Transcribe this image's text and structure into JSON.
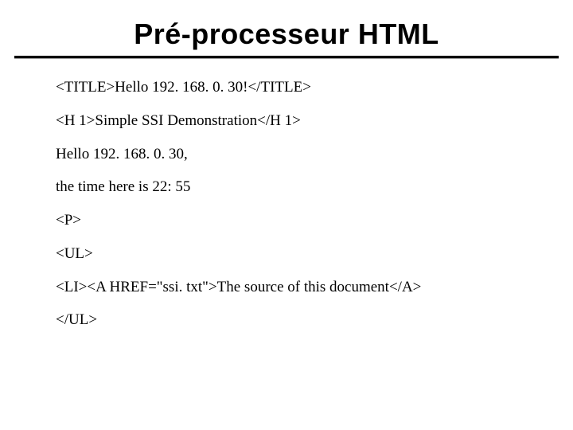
{
  "title": "Pré-processeur HTML",
  "lines": [
    "<TITLE>Hello 192. 168. 0. 30!</TITLE>",
    "<H 1>Simple SSI Demonstration</H 1>",
    "Hello 192. 168. 0. 30,",
    "the time here is 22: 55",
    "<P>",
    "<UL>",
    "<LI><A HREF=\"ssi. txt\">The source of this document</A>",
    "</UL>"
  ]
}
